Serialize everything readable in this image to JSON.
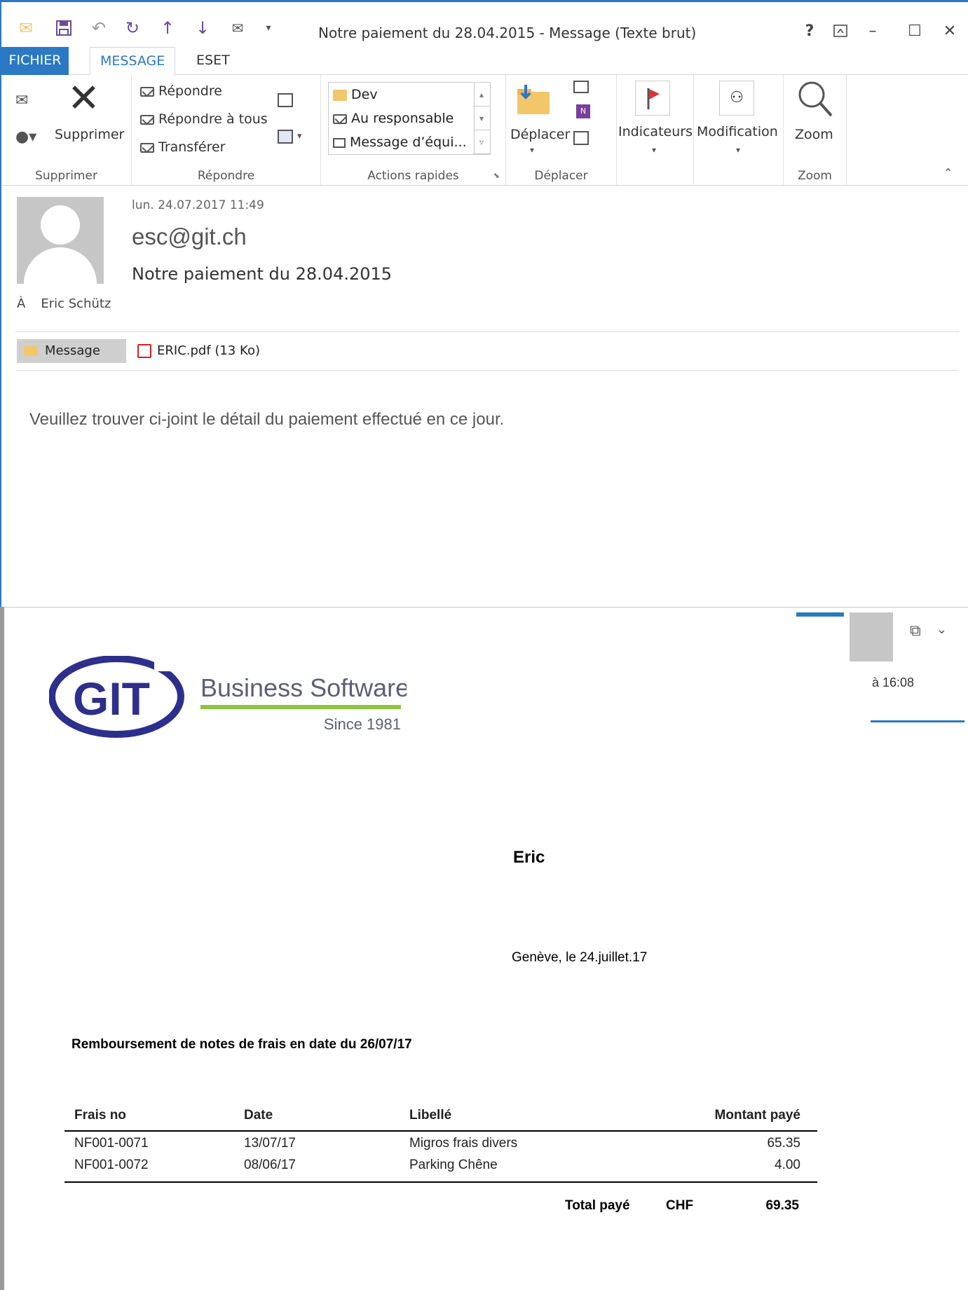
{
  "window": {
    "title": "Notre paiement du 28.04.2015 - Message (Texte brut)",
    "help": "?",
    "accent": "#2b78c4"
  },
  "tabs": [
    {
      "label": "FICHIER"
    },
    {
      "label": "MESSAGE"
    },
    {
      "label": "ESET"
    }
  ],
  "ribbon": {
    "delete_label": "Supprimer",
    "delete_group": "Supprimer",
    "reply": "Répondre",
    "reply_all": "Répondre à tous",
    "forward": "Transférer",
    "reply_group": "Répondre",
    "quick_steps": [
      "Dev",
      "Au responsable",
      "Message d’équi..."
    ],
    "quick_group": "Actions rapides",
    "move_label": "Déplacer",
    "move_group": "Déplacer",
    "tags_label": "Indicateurs",
    "edit_label": "Modification",
    "zoom_label": "Zoom",
    "zoom_group": "Zoom"
  },
  "message": {
    "datetime": "lun. 24.07.2017 11:49",
    "sender": "esc@git.ch",
    "subject": "Notre paiement du 28.04.2015",
    "to_prefix": "À",
    "to_name": "Eric Schütz",
    "message_tab": "Message",
    "attachment": "ERIC.pdf (13 Ko)",
    "body": "Veuillez trouver ci-joint le détail du paiement effectué en ce jour."
  },
  "floater": {
    "time": "à 16:08"
  },
  "pdf": {
    "logo_text": "GIT",
    "logo_title": "Business Software",
    "logo_since": "Since 1981",
    "recipient": "Eric",
    "place_date": "Genève, le  24.juillet.17",
    "heading": "Remboursement de notes de frais en date du 26/07/17",
    "columns": [
      "Frais no",
      "Date",
      "Libellé",
      "Montant payé"
    ],
    "rows": [
      {
        "no": "NF001-0071",
        "date": "13/07/17",
        "label": "Migros frais divers",
        "amount": "65.35"
      },
      {
        "no": "NF001-0072",
        "date": "08/06/17",
        "label": "Parking Chêne",
        "amount": "4.00"
      }
    ],
    "total_label": "Total payé",
    "currency": "CHF",
    "total": "69.35"
  }
}
